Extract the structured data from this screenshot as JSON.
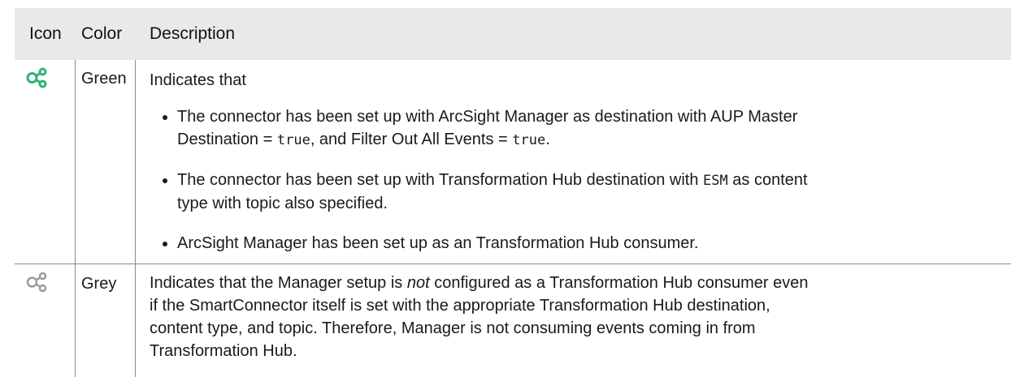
{
  "header": {
    "col_icon": "Icon",
    "col_color": "Color",
    "col_description": "Description"
  },
  "rows": [
    {
      "icon": "connector-nodes-icon",
      "icon_color": "#2db37a",
      "color": "Green",
      "intro": "Indicates that",
      "bullets": [
        {
          "p1": "The connector has been set up with ArcSight Manager as destination with AUP Master",
          "p2": "Destination = ",
          "code1": "true",
          "p3": ", and Filter Out All Events = ",
          "code2": "true",
          "p4": "."
        },
        {
          "p1": "The connector has been set up with Transformation Hub destination with ",
          "code1": "ESM",
          "p2": " as content",
          "p3": "type with topic also specified."
        },
        {
          "p1": "ArcSight Manager has been set up as an Transformation Hub consumer."
        }
      ]
    },
    {
      "icon": "connector-nodes-icon",
      "icon_color": "#9a9a9a",
      "color": "Grey",
      "desc_l1a": "Indicates that the Manager setup is ",
      "desc_l1em": "not",
      "desc_l1b": " configured as a Transformation Hub consumer even",
      "desc_l2": "if the SmartConnector itself is set with the appropriate Transformation Hub destination,",
      "desc_l3": "content type, and topic. Therefore, Manager is not consuming events coming in from",
      "desc_l4": "Transformation Hub."
    }
  ]
}
